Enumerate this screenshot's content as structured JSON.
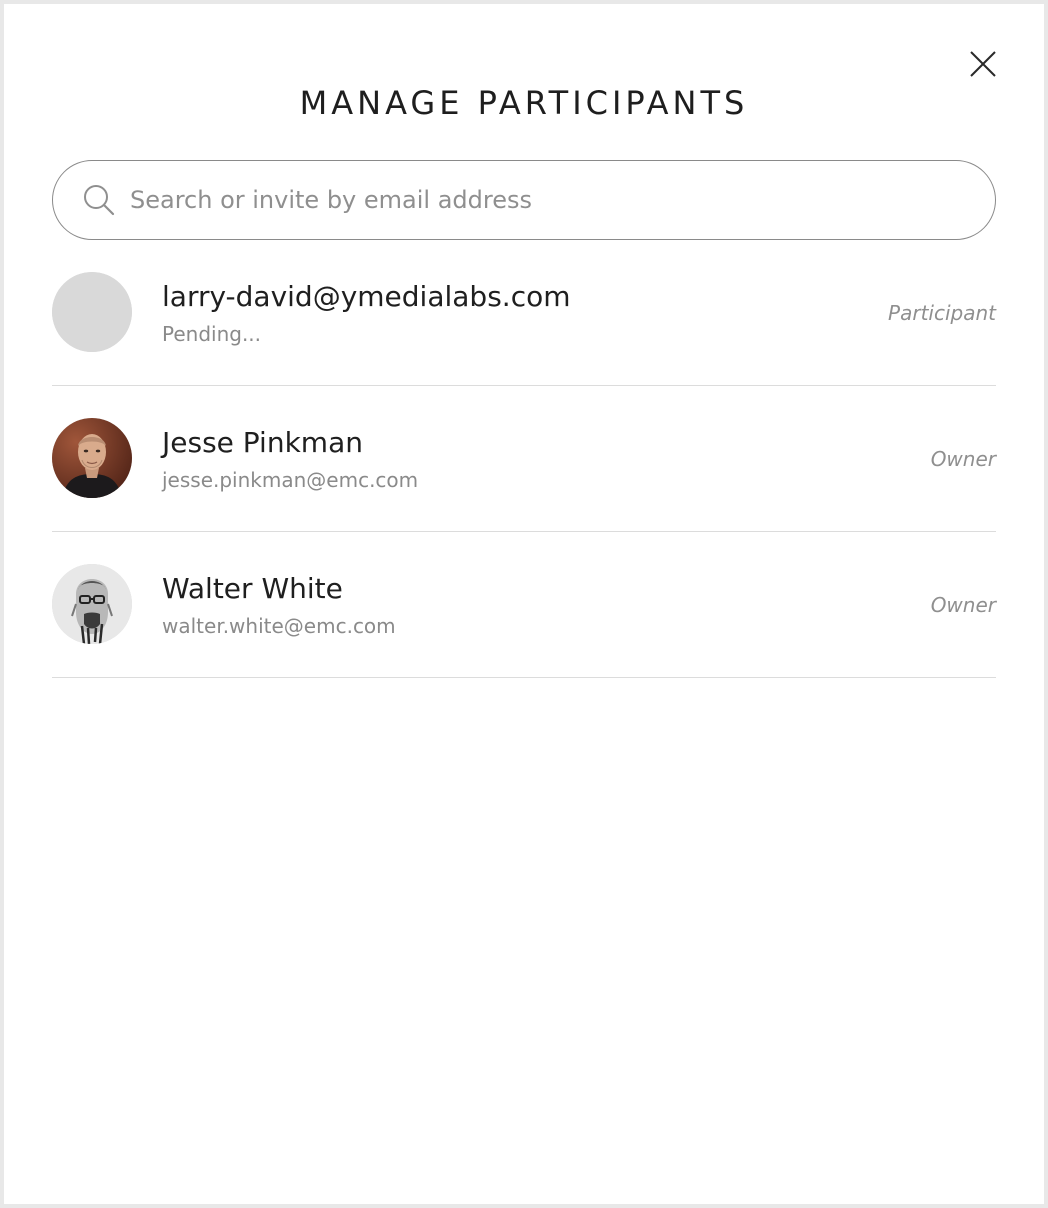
{
  "title": "MANAGE PARTICIPANTS",
  "search": {
    "placeholder": "Search or invite by email address",
    "value": ""
  },
  "participants": [
    {
      "name": "larry-david@ymedialabs.com",
      "subtitle": "Pending...",
      "role": "Participant",
      "avatar": "placeholder-avatar"
    },
    {
      "name": "Jesse Pinkman",
      "subtitle": "jesse.pinkman@emc.com",
      "role": "Owner",
      "avatar": "photo-avatar"
    },
    {
      "name": "Walter White",
      "subtitle": "walter.white@emc.com",
      "role": "Owner",
      "avatar": "sketch-avatar"
    }
  ],
  "icons": {
    "close": "close-icon",
    "search": "search-icon"
  },
  "colors": {
    "background": "#ffffff",
    "frame": "#e8e8e8",
    "text_primary": "#1f1f1f",
    "text_secondary": "#8a8a8a",
    "divider": "#dcdcdc",
    "placeholder_avatar": "#d9d9d9"
  }
}
